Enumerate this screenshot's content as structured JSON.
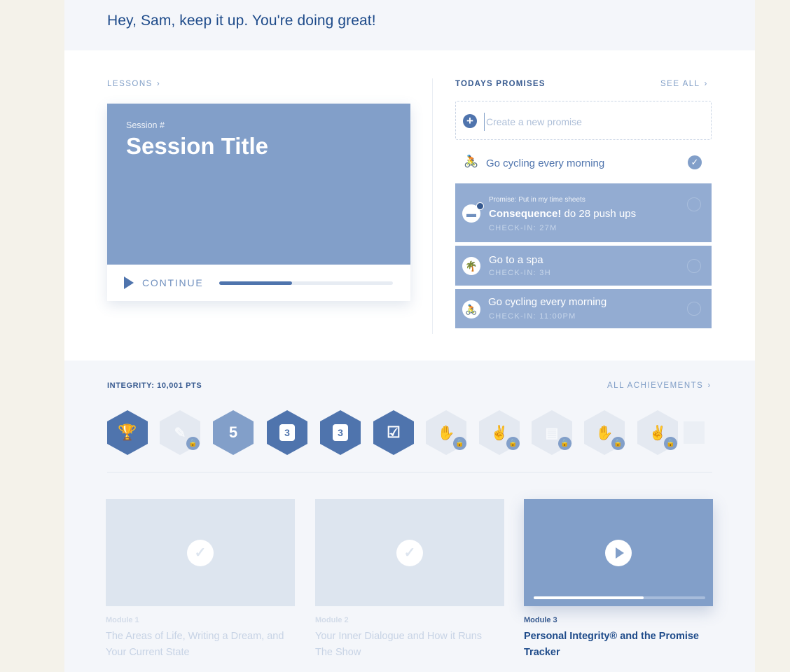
{
  "greeting": "Hey, Sam, keep it up. You're doing great!",
  "lessons": {
    "label": "LESSONS",
    "session_number": "Session #",
    "session_title": "Session Title",
    "continue_label": "CONTINUE",
    "progress": 0.42
  },
  "promises": {
    "label": "TODAYS PROMISES",
    "see_all": "SEE ALL",
    "new_placeholder": "Create a new promise",
    "completed": {
      "text": "Go cycling every morning",
      "icon": "runner-icon",
      "done": true
    },
    "items": [
      {
        "context": "Promise: Put in my time sheets",
        "title_bold": "Consequence!",
        "title_rest": " do 28 push ups",
        "checkin": "CHECK-IN: 27M",
        "icon": "briefcase-icon",
        "has_notification": true
      },
      {
        "title": "Go to a spa",
        "checkin": "CHECK-IN: 3H",
        "icon": "palm-tree-icon"
      },
      {
        "title": "Go cycling every morning",
        "checkin": "CHECK-IN: 11:00PM",
        "icon": "runner-icon"
      }
    ]
  },
  "integrity": {
    "label": "INTEGRITY: 10,001 PTS",
    "all_achievements": "ALL ACHIEVEMENTS",
    "badges": [
      {
        "name": "trophy-badge",
        "glyph": "🏆",
        "unlocked": true
      },
      {
        "name": "broken-heart-badge",
        "glyph": "✎",
        "unlocked": false
      },
      {
        "name": "five-streak-badge",
        "glyph": "5",
        "unlocked": true
      },
      {
        "name": "three-play-badge",
        "glyph": "3",
        "unlocked": true
      },
      {
        "name": "three-shield-badge",
        "glyph": "3",
        "unlocked": true
      },
      {
        "name": "calendar-badge",
        "glyph": "☑",
        "unlocked": true
      },
      {
        "name": "hand-badge",
        "glyph": "✋",
        "unlocked": false
      },
      {
        "name": "handshake-badge",
        "glyph": "✌",
        "unlocked": false
      },
      {
        "name": "document-badge",
        "glyph": "▤",
        "unlocked": false
      },
      {
        "name": "hand-badge-2",
        "glyph": "✋",
        "unlocked": false
      },
      {
        "name": "handshake-badge-2",
        "glyph": "✌",
        "unlocked": false
      }
    ]
  },
  "modules": [
    {
      "number": "Module 1",
      "title": "The Areas of Life, Writing a Dream, and Your Current State",
      "status": "complete"
    },
    {
      "number": "Module 2",
      "title": "Your Inner Dialogue and How it Runs The Show",
      "status": "complete"
    },
    {
      "number": "Module 3",
      "title": "Personal Integrity® and the Promise Tracker",
      "status": "in-progress",
      "progress": 0.64
    }
  ],
  "colors": {
    "accent": "#4f74ad",
    "card": "#829fc9",
    "promise_card": "#93acd2",
    "text": "#1e4b8a"
  }
}
